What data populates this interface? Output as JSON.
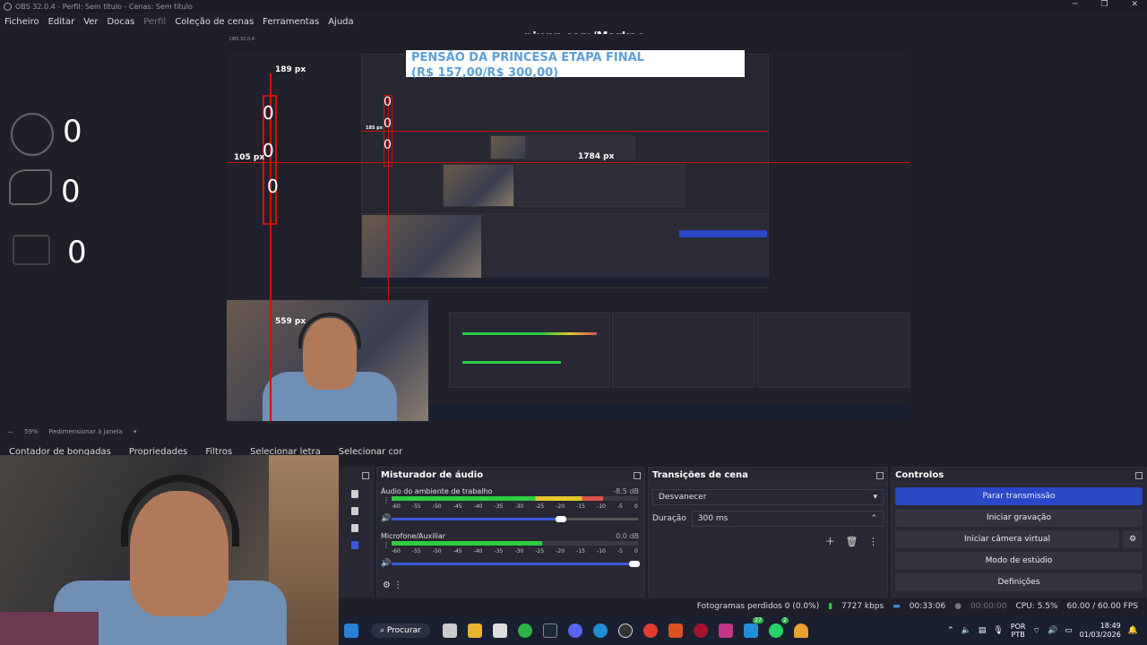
{
  "window": {
    "title": "OBS 32.0.4 - Perfil: Sem título - Cenas: Sem título"
  },
  "menu": [
    {
      "label": "Ficheiro"
    },
    {
      "label": "Editar"
    },
    {
      "label": "Ver"
    },
    {
      "label": "Docas"
    },
    {
      "label": "Perfil",
      "disabled": true
    },
    {
      "label": "Coleção de cenas"
    },
    {
      "label": "Ferramentas"
    },
    {
      "label": "Ajuda"
    }
  ],
  "preview": {
    "url_overlay": "pixgg.com/Markao",
    "banner_line1": "PENSÃO DA PRINCESA ETAPA FINAL",
    "banner_line2": "(R$ 157,00/R$ 300,00)",
    "counters_left": [
      "0",
      "0",
      "0"
    ],
    "counters_inner": [
      "0",
      "0",
      "0"
    ],
    "counters_nested": [
      "0",
      "0",
      "0",
      "0"
    ],
    "px_labels": {
      "top": "189 px",
      "left": "105 px",
      "bottom": "559 px",
      "right": "1784 px",
      "mid": "185 px"
    }
  },
  "zoom_bar": {
    "zoom": "59%",
    "label": "Redimensionar à janela"
  },
  "source_tabs": [
    {
      "label": "Contador de bongadas"
    },
    {
      "label": "Propriedades"
    },
    {
      "label": "Filtros"
    },
    {
      "label": "Selecionar letra"
    },
    {
      "label": "Selecionar cor"
    }
  ],
  "mixer": {
    "title": "Misturador de áudio",
    "channels": [
      {
        "name": "Áudio do ambiente de trabalho",
        "db": "-8.5 dB",
        "level_pct": 86,
        "volume_pct": 68
      },
      {
        "name": "Microfone/Auxiliar",
        "db": "0.0 dB",
        "level_pct": 61,
        "volume_pct": 100
      }
    ],
    "ticks": [
      "-60",
      "-55",
      "-50",
      "-45",
      "-40",
      "-35",
      "-30",
      "-25",
      "-20",
      "-15",
      "-10",
      "-5",
      "0"
    ]
  },
  "transitions": {
    "title": "Transições de cena",
    "selected": "Desvanecer",
    "duration_label": "Duração",
    "duration_value": "300 ms"
  },
  "controls": {
    "title": "Controlos",
    "buttons": [
      {
        "label": "Parar transmissão",
        "primary": true
      },
      {
        "label": "Iniciar gravação"
      },
      {
        "label": "Iniciar câmera virtual"
      },
      {
        "label": "Modo de estúdio"
      },
      {
        "label": "Definições"
      }
    ]
  },
  "status": {
    "dropped": "Fotogramas perdidos 0 (0.0%)",
    "bitrate": "7727 kbps",
    "stream_time": "00:33:06",
    "rec_time": "00:00:00",
    "cpu": "CPU: 5.5%",
    "fps": "60.00 / 60.00 FPS"
  },
  "taskbar": {
    "search": "Procurar",
    "lang_top": "POR",
    "lang_bottom": "PTB",
    "time": "18:49",
    "date": "01/03/2026",
    "badge1": "27",
    "badge2": "2"
  }
}
